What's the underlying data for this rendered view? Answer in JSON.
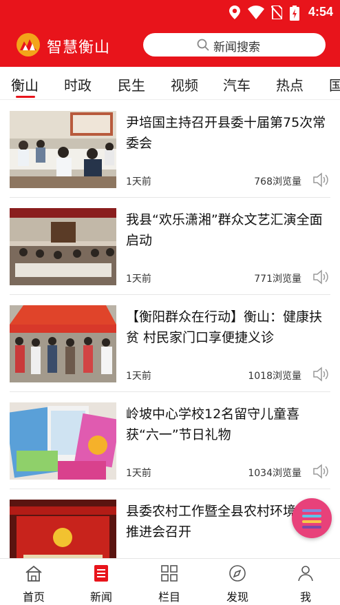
{
  "status_bar": {
    "time": "4:54"
  },
  "header": {
    "app_title": "智慧衡山",
    "search_placeholder": "新闻搜索"
  },
  "tabs": [
    {
      "label": "衡山",
      "active": true
    },
    {
      "label": "时政"
    },
    {
      "label": "民生"
    },
    {
      "label": "视频"
    },
    {
      "label": "汽车"
    },
    {
      "label": "热点"
    },
    {
      "label": "国"
    }
  ],
  "news": [
    {
      "title": "尹培国主持召开县委十届第75次常委会",
      "time": "1天前",
      "views": "768浏览量"
    },
    {
      "title": "我县“欢乐潇湘”群众文艺汇演全面启动",
      "time": "1天前",
      "views": "771浏览量"
    },
    {
      "title": "【衡阳群众在行动】衡山：健康扶贫 村民家门口享便捷义诊",
      "time": "1天前",
      "views": "1018浏览量"
    },
    {
      "title": "岭坡中心学校12名留守儿童喜获“六一”节日礼物",
      "time": "1天前",
      "views": "1034浏览量"
    },
    {
      "title": "县委农村工作暨全县农村环境整治推进会召开",
      "time": "",
      "views": ""
    }
  ],
  "bottom_nav": [
    {
      "label": "首页"
    },
    {
      "label": "新闻",
      "active": true
    },
    {
      "label": "栏目"
    },
    {
      "label": "发现"
    },
    {
      "label": "我"
    }
  ],
  "colors": {
    "brand_red": "#e8141b",
    "fab_pink": "#e8417a"
  },
  "icons": [
    "location-icon",
    "wifi-icon",
    "no-sim-icon",
    "battery-icon",
    "search-icon",
    "speaker-icon",
    "home-icon",
    "news-icon",
    "grid-icon",
    "discover-icon",
    "user-icon"
  ]
}
